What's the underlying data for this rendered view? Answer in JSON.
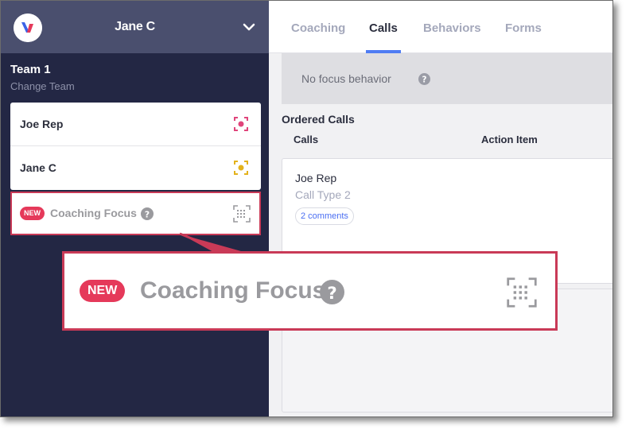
{
  "user": {
    "name": "Jane C"
  },
  "team": {
    "name": "Team 1",
    "change_label": "Change Team"
  },
  "members": [
    {
      "name": "Joe Rep",
      "icon": "focus-target-icon",
      "color": "#e0457b"
    },
    {
      "name": "Jane C",
      "icon": "focus-target-icon",
      "color": "#e3b21c"
    }
  ],
  "coaching_focus": {
    "badge": "NEW",
    "label": "Coaching Focus",
    "help_icon": "help-icon",
    "icon": "qr-grid-icon"
  },
  "tabs": [
    {
      "label": "Coaching",
      "active": false
    },
    {
      "label": "Calls",
      "active": true
    },
    {
      "label": "Behaviors",
      "active": false
    },
    {
      "label": "Forms",
      "active": false
    }
  ],
  "focus": {
    "text": "No focus behavior"
  },
  "ordered_calls": {
    "title": "Ordered Calls",
    "columns": [
      "Calls",
      "Action Item"
    ],
    "calls": [
      {
        "rep": "Joe Rep",
        "type": "Call Type 2",
        "comments": "2 comments"
      }
    ]
  },
  "colors": {
    "accent": "#4f7cf3",
    "new_badge": "#e5395a",
    "callout": "#c93a57",
    "sidebar": "#232744"
  }
}
